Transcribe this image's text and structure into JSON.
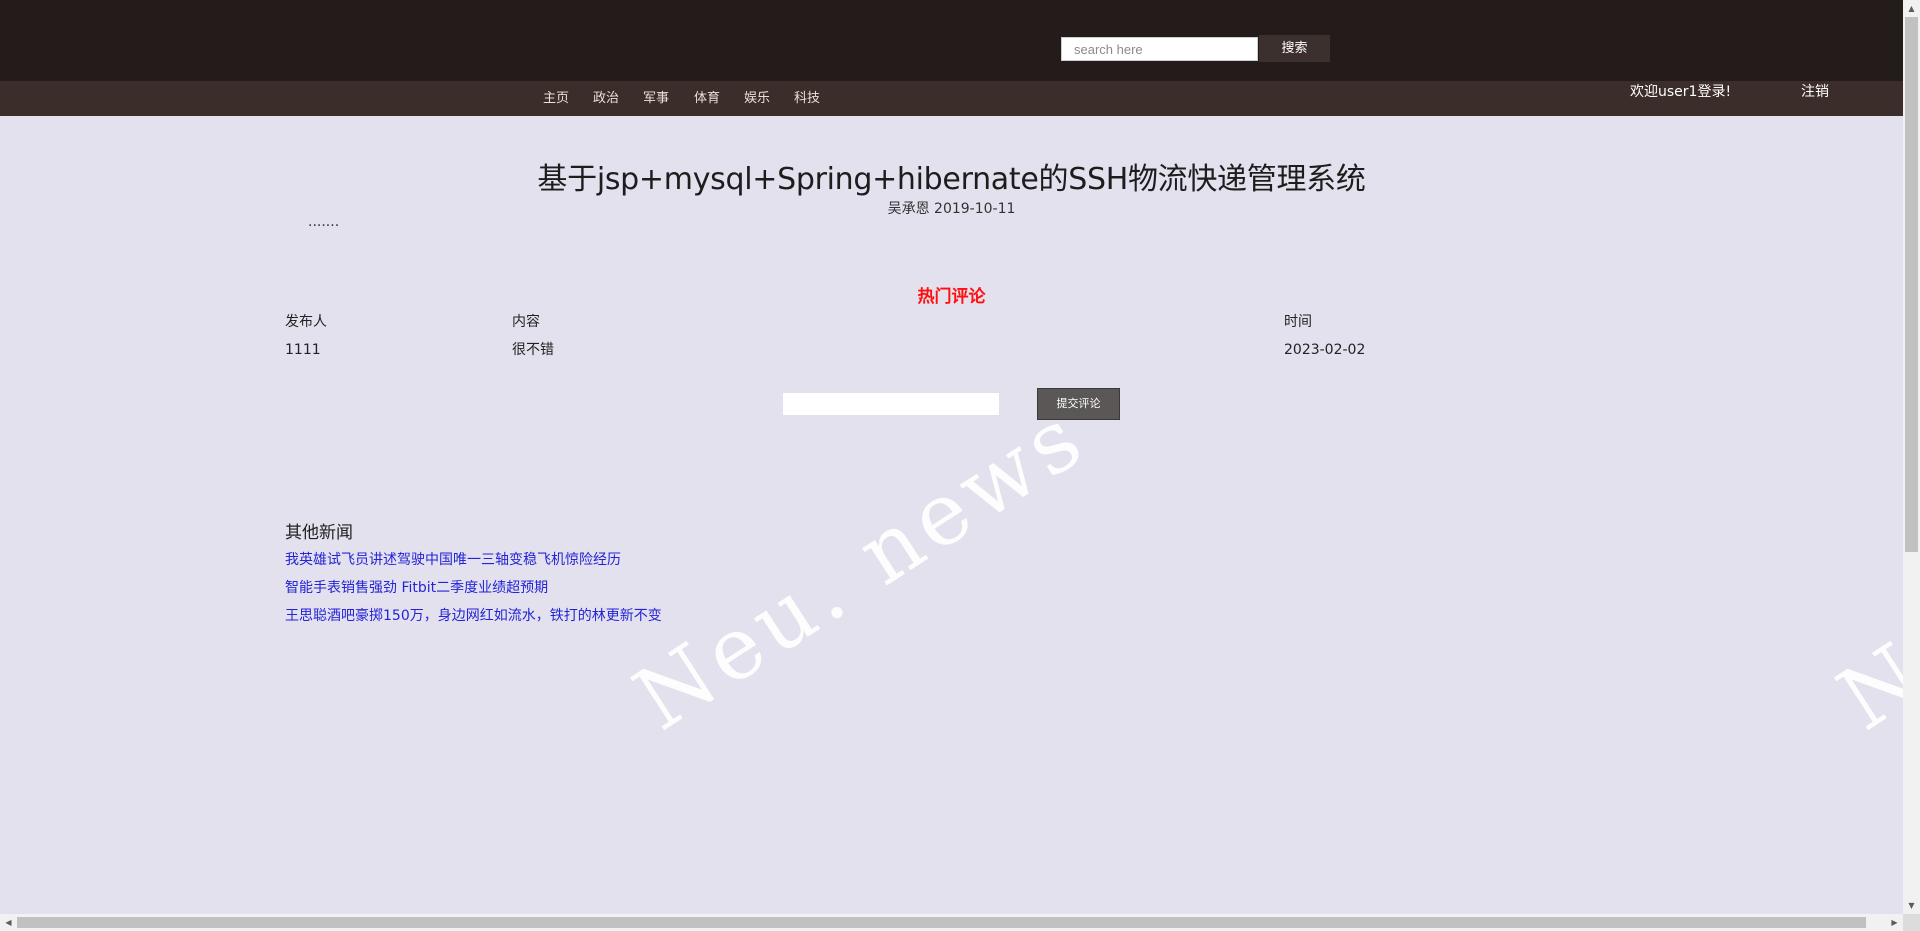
{
  "header": {
    "search": {
      "placeholder": "search here",
      "value": ""
    },
    "search_button": "搜索",
    "nav": [
      {
        "label": "主页"
      },
      {
        "label": "政治"
      },
      {
        "label": "军事"
      },
      {
        "label": "体育"
      },
      {
        "label": "娱乐"
      },
      {
        "label": "科技"
      }
    ],
    "welcome": "欢迎user1登录!",
    "logout": "注销"
  },
  "article": {
    "title": "基于jsp+mysql+Spring+hibernate的SSH物流快递管理系统",
    "meta": "吴承恩 2019-10-11",
    "body": "......."
  },
  "comments": {
    "title": "热门评论",
    "columns": [
      "发布人",
      "内容",
      "时间"
    ],
    "rows": [
      {
        "author": "1111",
        "content": "很不错",
        "time": "2023-02-02"
      }
    ],
    "input_value": "",
    "submit_label": "提交评论"
  },
  "other_news": {
    "title": "其他新闻",
    "items": [
      {
        "label": "我英雄试飞员讲述驾驶中国唯一三轴变稳飞机惊险经历"
      },
      {
        "label": "智能手表销售强劲 Fitbit二季度业绩超预期"
      },
      {
        "label": "王思聪酒吧豪掷150万，身边网红如流水，铁打的林更新不变"
      }
    ]
  },
  "watermark": "Neu. news",
  "colors": {
    "topbar": "#231c1b",
    "navbar": "#3b2d29",
    "page_bg": "#e3e1ed",
    "hot_title": "#ff1010",
    "link": "#2424d6"
  },
  "icons": {
    "scroll_up": "▲",
    "scroll_down": "▼",
    "scroll_left": "◀",
    "scroll_right": "▶"
  }
}
